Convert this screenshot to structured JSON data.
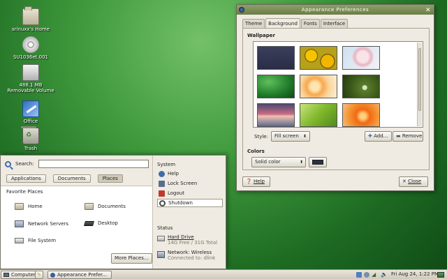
{
  "desktop": {
    "icons": [
      {
        "label": "srinuxx's Home",
        "icon": "home-folder-icon"
      },
      {
        "label": "SU1036et.001",
        "icon": "cd-disc-icon"
      },
      {
        "label": "488.1 MB",
        "label2": "Removable Volume",
        "icon": "drive-icon"
      },
      {
        "label": "Office",
        "icon": "office-icon"
      },
      {
        "label": "Trash",
        "icon": "trash-icon"
      }
    ]
  },
  "window": {
    "title": "Appearance Preferences",
    "tabs": [
      "Theme",
      "Background",
      "Fonts",
      "Interface"
    ],
    "active_tab": "Background",
    "wallpaper_heading": "Wallpaper",
    "style_label": "Style:",
    "style_value": "Fill screen",
    "add_label": "Add...",
    "remove_label": "Remove",
    "colors_heading": "Colors",
    "color_mode": "Solid color",
    "swatch_color": "#2a3145",
    "help_label": "Help",
    "close_label": "Close"
  },
  "menu": {
    "search_label": "Search:",
    "search_value": "",
    "tabs": [
      "Applications",
      "Documents",
      "Places"
    ],
    "active_tab": "Places",
    "favorites_heading": "Favorite Places",
    "places": [
      "Home",
      "Documents",
      "Network Servers",
      "Desktop",
      "File System"
    ],
    "more_label": "More Places...",
    "system_heading": "System",
    "system_items": [
      "Help",
      "Lock Screen",
      "Logout",
      "Shutdown"
    ],
    "status_heading": "Status",
    "hard_drive": {
      "title": "Hard Drive",
      "detail": "14G Free / 31G Total"
    },
    "network": {
      "title": "Network: Wireless",
      "detail": "Connected to: dlink"
    }
  },
  "taskbar": {
    "computer_label": "Computer",
    "task_label": "Appearance Prefer...",
    "clock": "Fri Aug 24,  1:22 PM"
  }
}
